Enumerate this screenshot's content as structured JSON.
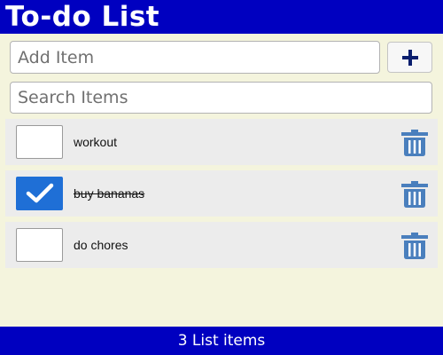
{
  "header": {
    "title": "To-do List"
  },
  "add": {
    "placeholder": "Add Item",
    "button_icon": "plus-icon"
  },
  "search": {
    "placeholder": "Search Items"
  },
  "items": [
    {
      "label": "workout",
      "checked": false
    },
    {
      "label": "buy bananas",
      "checked": true
    },
    {
      "label": "do chores",
      "checked": false
    }
  ],
  "footer": {
    "count_text": "3 List items"
  },
  "colors": {
    "header_bg": "#0000c0",
    "page_bg": "#f4f4dd",
    "row_bg": "#ececec",
    "checked_blue": "#1f6fd6",
    "trash_blue": "#4a7fbd",
    "plus_navy": "#0a1e6e"
  }
}
